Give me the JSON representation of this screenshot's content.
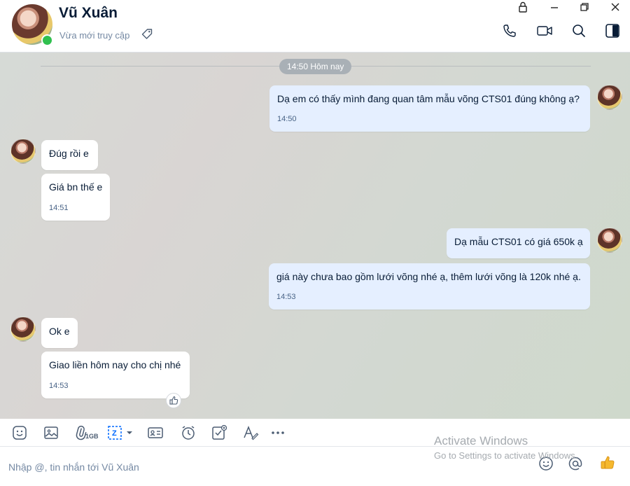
{
  "header": {
    "name": "Vũ Xuân",
    "status": "Vừa mới truy cập"
  },
  "chat": {
    "date_divider": "14:50 Hôm nay",
    "messages": [
      {
        "dir": "out",
        "text": "Dạ em có thấy mình đang quan tâm mẫu võng CTS01 đúng không ạ?",
        "time": "14:50"
      },
      {
        "dir": "in",
        "text": "Đúg rồi e",
        "time": ""
      },
      {
        "dir": "in",
        "text": "Giá bn thế e",
        "time": "14:51"
      },
      {
        "dir": "out",
        "text": "Dạ mẫu CTS01 có giá 650k  ạ",
        "time": ""
      },
      {
        "dir": "out",
        "text": "giá này chưa bao gồm lưới võng nhé ạ, thêm lưới võng là 120k nhé ạ.",
        "time": "14:53"
      },
      {
        "dir": "in",
        "text": "Ok e",
        "time": ""
      },
      {
        "dir": "in",
        "text": "Giao liền hôm nay cho chị nhé",
        "time": "14:53"
      }
    ]
  },
  "toolbar": {
    "file_limit": "1GB",
    "icons": [
      "sticker-icon",
      "image-icon",
      "attach-icon",
      "screenshot-icon",
      "contact-card-icon",
      "reminder-icon",
      "task-icon",
      "format-text-icon",
      "more-icon"
    ]
  },
  "composer": {
    "placeholder": "Nhập @, tin nhắn tới Vũ Xuân"
  },
  "os_watermark": {
    "title": "Activate Windows",
    "subtitle": "Go to Settings to activate Windows."
  },
  "colors": {
    "outgoing_bubble": "#e5efff",
    "incoming_bubble": "#ffffff",
    "online": "#30c04f",
    "like": "#f5b82e"
  }
}
